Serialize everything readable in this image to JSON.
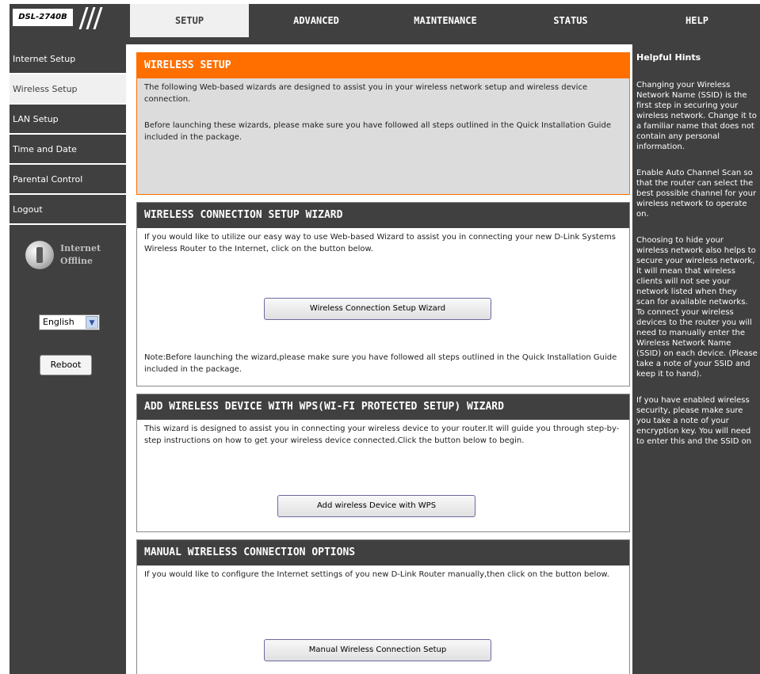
{
  "logo": {
    "text": "DSL-2740B"
  },
  "tabs": [
    {
      "label": "SETUP",
      "active": true
    },
    {
      "label": "ADVANCED",
      "active": false
    },
    {
      "label": "MAINTENANCE",
      "active": false
    },
    {
      "label": "STATUS",
      "active": false
    },
    {
      "label": "HELP",
      "active": false
    }
  ],
  "sidebar": {
    "items": [
      {
        "label": "Internet Setup"
      },
      {
        "label": "Wireless Setup"
      },
      {
        "label": "LAN Setup"
      },
      {
        "label": "Time and Date"
      },
      {
        "label": "Parental Control"
      },
      {
        "label": "Logout"
      }
    ],
    "status_line1": "Internet",
    "status_line2": "Offline",
    "language": "English",
    "reboot_label": "Reboot"
  },
  "wireless_setup": {
    "title": "WIRELESS SETUP",
    "p1": "The following Web-based wizards are designed to assist you in your wireless network setup and wireless device connection.",
    "p2": "Before launching these wizards, please make sure you have followed all steps outlined in the Quick Installation Guide included in the package."
  },
  "connection_wizard": {
    "title": "WIRELESS CONNECTION SETUP WIZARD",
    "p1": "If you would like to utilize our easy way to use Web-based Wizard to assist you in connecting your new D-Link Systems Wireless Router to the Internet, click on the button below.",
    "button": "Wireless Connection Setup Wizard",
    "note": "Note:Before launching the wizard,please make sure you have followed all steps outlined in the Quick Installation Guide included in the package."
  },
  "wps_wizard": {
    "title": "ADD WIRELESS DEVICE WITH WPS(WI-FI PROTECTED SETUP) WIZARD",
    "p1": "This wizard is designed to assist you in connecting your wireless device to your router.It will guide you through step-by-step instructions on how to get your wireless device connected.Click the button below to begin.",
    "button": "Add wireless Device with WPS"
  },
  "manual_options": {
    "title": "MANUAL WIRELESS CONNECTION OPTIONS",
    "p1": "If you would like to configure the Internet settings of you new D-Link Router manually,then click on the button below.",
    "button": "Manual Wireless Connection Setup"
  },
  "hints": {
    "title": "Helpful Hints",
    "h1": "Changing your Wireless Network Name (SSID) is the first step in securing your wireless network. Change it to a familiar name that does not contain any personal information.",
    "h2": "Enable Auto Channel Scan so that the router can select the best possible channel for your wireless network to operate on.",
    "h3": "Choosing to hide your wireless network also helps to secure your wireless network, it will mean that wireless clients will not see your network listed when they scan for available networks. To connect your wireless devices to the router you will need to manually enter the Wireless Network Name (SSID) on each device. (Please take a note of your SSID and keep it to hand).",
    "h4": "If you have enabled wireless security, please make sure you take a note of your encryption key. You will need to enter this and the SSID on"
  },
  "colors": {
    "frame": "#404040",
    "accent_orange": "#ff6f00",
    "active_tab": "#f0f0f0"
  }
}
